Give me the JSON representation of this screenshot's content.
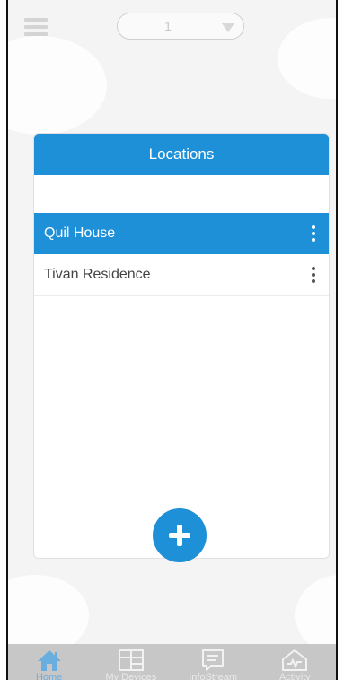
{
  "header": {
    "selector_value": "1"
  },
  "locations": {
    "title": "Locations",
    "items": [
      {
        "name": "Quil House",
        "selected": true
      },
      {
        "name": "Tivan Residence",
        "selected": false
      }
    ]
  },
  "tabbar": {
    "tabs": [
      {
        "label": "Home",
        "icon": "home-icon",
        "active": true
      },
      {
        "label": "My Devices",
        "icon": "devices-icon",
        "active": false
      },
      {
        "label": "InfoStream",
        "icon": "infostream-icon",
        "active": false
      },
      {
        "label": "Activity",
        "icon": "activity-icon",
        "active": false
      }
    ]
  },
  "colors": {
    "accent": "#1e90d8",
    "tabbar_bg": "#c7c7c7",
    "active_tab": "#6aaee0"
  }
}
